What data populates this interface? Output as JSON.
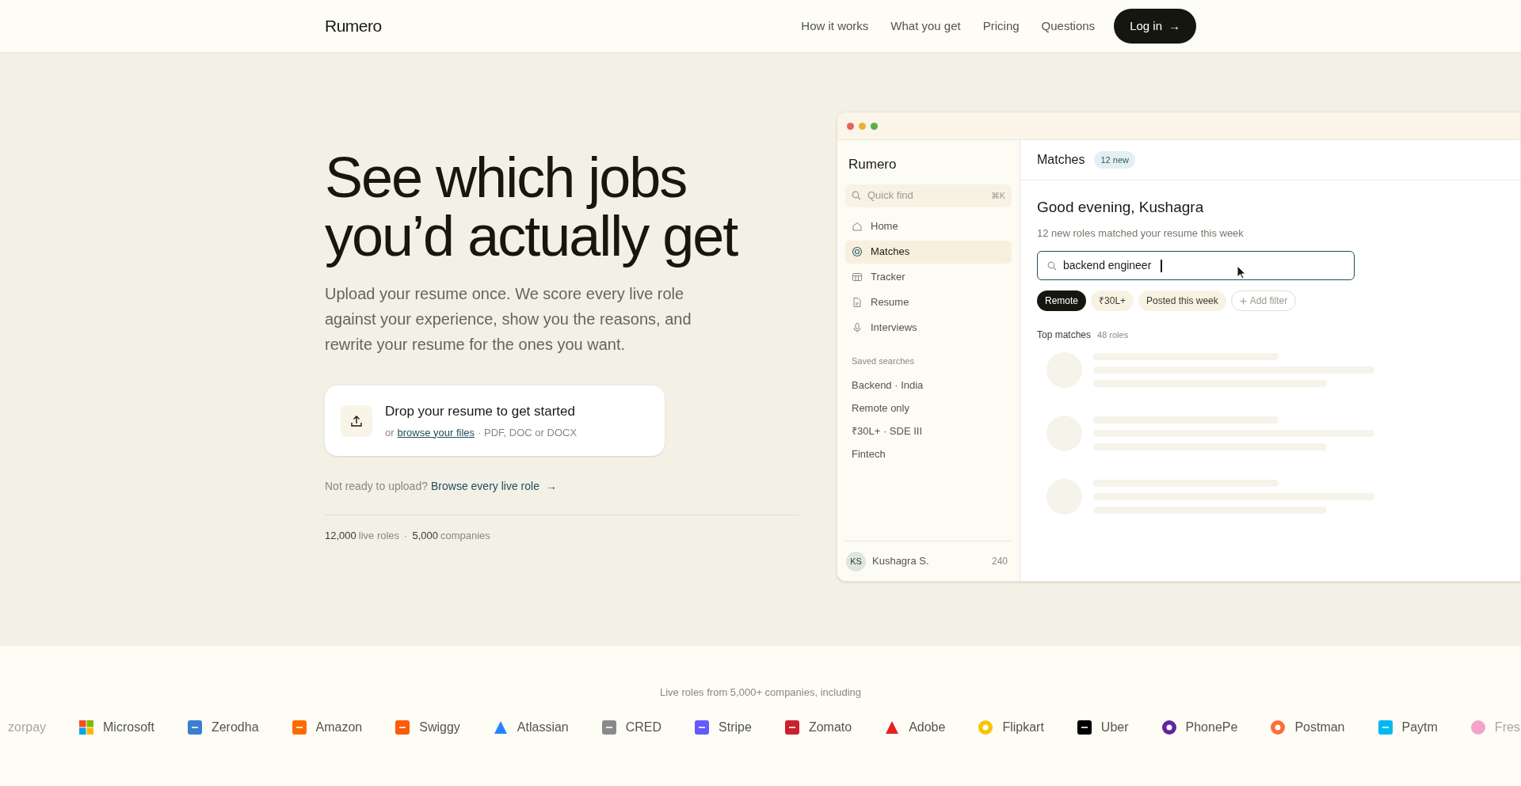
{
  "nav": {
    "logo": "Rumero",
    "links": [
      "How it works",
      "What you get",
      "Pricing",
      "Questions"
    ],
    "login": {
      "label": "Log in",
      "arrow": "→"
    }
  },
  "hero": {
    "headline": "See which jobs you’d actually get",
    "intro": "Upload your resume once. We score every live role against your experience, show you the reasons, and rewrite your resume for the ones you want.",
    "dropzone": {
      "title": "Drop your resume to get started",
      "prefix": "or",
      "link": "browse your files",
      "formats": "· PDF, DOC or DOCX"
    },
    "browse": {
      "prompt": "Not ready to upload?",
      "link": "Browse every live role",
      "arrow": "→"
    },
    "stats": [
      {
        "number": "12,000",
        "unit": "live roles"
      },
      {
        "number": "5,000",
        "unit": "companies"
      }
    ],
    "stats_separator": "·"
  },
  "app": {
    "sidebar": {
      "logo": "Rumero",
      "quick_find": {
        "placeholder": "Quick find",
        "shortcut": "⌘K"
      },
      "nav_items": [
        {
          "label": "Home",
          "selected": false
        },
        {
          "label": "Matches",
          "selected": true
        },
        {
          "label": "Tracker",
          "selected": false
        },
        {
          "label": "Resume",
          "selected": false
        },
        {
          "label": "Interviews",
          "selected": false
        }
      ],
      "saved_heading": "Saved searches",
      "saved_searches": [
        "Backend · India",
        "Remote only",
        "₹30L+ · SDE III",
        "Fintech"
      ],
      "user": {
        "initials": "KS",
        "name": "Kushagra S.",
        "count": "240"
      }
    },
    "main": {
      "title": "Matches",
      "badge": "12 new",
      "greeting": "Good evening, Kushagra",
      "subtitle": "12 new roles matched your resume this week",
      "search": {
        "value": "backend engineer"
      },
      "filters": [
        {
          "label": "Remote",
          "kind": "active"
        },
        {
          "label": "₹30L+",
          "kind": "chip"
        },
        {
          "label": "Posted this week",
          "kind": "chip"
        },
        {
          "label": "Add filter",
          "kind": "add"
        }
      ],
      "results_heading": "Top matches",
      "results_count": "48 roles"
    }
  },
  "companies": {
    "caption": "Live roles from 5,000+ companies, including",
    "logos": [
      {
        "name": "zorpay",
        "kind": "faded"
      },
      {
        "name": "Microsoft",
        "kind": "grid",
        "color": "#f25022"
      },
      {
        "name": "Zerodha",
        "kind": "square",
        "color": "#387ed1"
      },
      {
        "name": "Amazon",
        "kind": "square",
        "color": "#ff6a00"
      },
      {
        "name": "Swiggy",
        "kind": "square",
        "color": "#fc5a03"
      },
      {
        "name": "Atlassian",
        "kind": "triangle",
        "color": "#2684ff"
      },
      {
        "name": "CRED",
        "kind": "square",
        "color": "#8a8a8a"
      },
      {
        "name": "Stripe",
        "kind": "square",
        "color": "#635bff"
      },
      {
        "name": "Zomato",
        "kind": "square",
        "color": "#cb202d"
      },
      {
        "name": "Adobe",
        "kind": "triangle",
        "color": "#e5211e"
      },
      {
        "name": "Flipkart",
        "kind": "circle",
        "color": "#f7c600"
      },
      {
        "name": "Uber",
        "kind": "square",
        "color": "#000000"
      },
      {
        "name": "PhonePe",
        "kind": "circle",
        "color": "#5f259f"
      },
      {
        "name": "Postman",
        "kind": "circle",
        "color": "#ff6c37"
      },
      {
        "name": "Paytm",
        "kind": "square",
        "color": "#00b9f1"
      },
      {
        "name": "Fres",
        "kind": "faded",
        "color": "#f3a3c8"
      }
    ]
  }
}
